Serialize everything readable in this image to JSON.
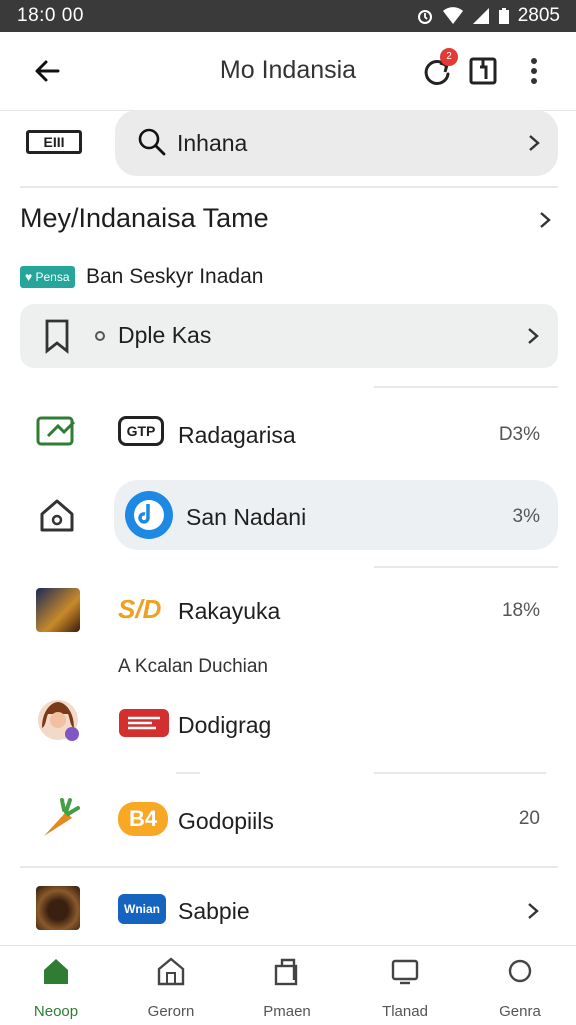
{
  "status": {
    "time": "18:0 00",
    "battery": "2805"
  },
  "appbar": {
    "title": "Mo Indansia",
    "badge": "2"
  },
  "search": {
    "logo_text": "EIII",
    "text": "Inhana"
  },
  "section": {
    "heading": "Mey/Indanaisa Tame",
    "pill": "Pensa",
    "subtitle": "Ban Seskyr Inadan"
  },
  "bookmark_row": {
    "text": "Dple Kas"
  },
  "list": [
    {
      "label": "Radagarisa",
      "value": "D3%",
      "logo_text": "GTP",
      "left_icon": "tv-icon",
      "logo_color": "#222222"
    },
    {
      "label": "San Nadani",
      "value": "3%",
      "left_icon": "home-icon",
      "logo_color": "#1e88e5"
    },
    {
      "label": "Rakayuka",
      "value": "18%",
      "logo_text": "S/D",
      "left_icon": "game-thumb",
      "logo_color": "#f0a020"
    },
    {
      "label": "Dodigrag",
      "value": "",
      "left_icon": "avatar",
      "logo_color": "#d32f2f"
    },
    {
      "label": "Godopiils",
      "value": "20",
      "logo_text": "B4",
      "left_icon": "carrot-icon",
      "logo_color": "#f9a825"
    },
    {
      "label": "Sabpie",
      "value": "",
      "logo_text": "Wnian",
      "left_icon": "coffee-thumb",
      "logo_color": "#1565c0"
    }
  ],
  "note": "A Kcalan Duchian",
  "nav": [
    {
      "label": "Neoop",
      "icon": "home-icon"
    },
    {
      "label": "Gerorn",
      "icon": "store-icon"
    },
    {
      "label": "Pmaen",
      "icon": "library-icon"
    },
    {
      "label": "Tlanad",
      "icon": "tablet-icon"
    },
    {
      "label": "Genra",
      "icon": "circle-icon"
    }
  ],
  "colors": {
    "accent": "#2e7d32",
    "teal": "#26a69a",
    "badge": "#e53935"
  }
}
